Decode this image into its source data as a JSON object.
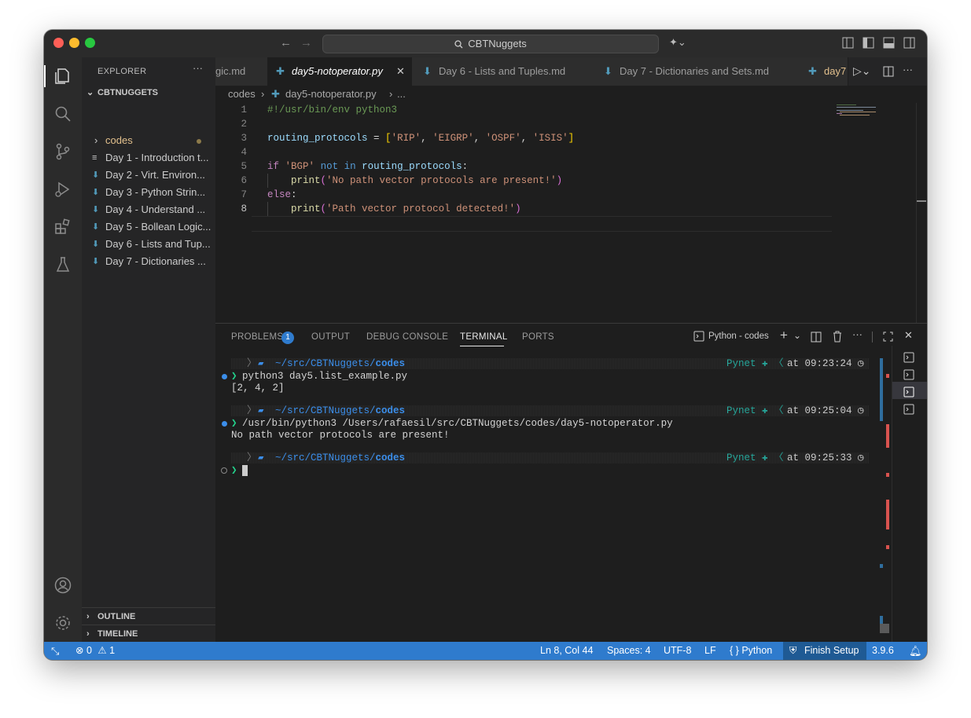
{
  "window": {
    "title": "CBTNuggets",
    "traffic_lights": {
      "close": "#ff5f57",
      "minimize": "#febc2e",
      "zoom": "#28c840"
    }
  },
  "sidebar": {
    "header": "EXPLORER",
    "project": "CBTNUGGETS",
    "items": [
      {
        "label": "codes",
        "type": "folder",
        "color": "#e2c08d"
      },
      {
        "label": "Day 1 - Introduction t...",
        "type": "md-plain"
      },
      {
        "label": "Day 2 - Virt. Environ...",
        "type": "md"
      },
      {
        "label": "Day 3 - Python Strin...",
        "type": "md"
      },
      {
        "label": "Day 4 - Understand ...",
        "type": "md"
      },
      {
        "label": "Day 5 - Bollean Logic...",
        "type": "md"
      },
      {
        "label": "Day 6 - Lists and Tup...",
        "type": "md"
      },
      {
        "label": "Day 7 - Dictionaries ..."
      }
    ],
    "outline": "OUTLINE",
    "timeline": "TIMELINE"
  },
  "tabs": [
    {
      "label": "gic.md"
    },
    {
      "label": "day5-notoperator.py",
      "active": true
    },
    {
      "label": "Day 6 - Lists and Tuples.md"
    },
    {
      "label": "Day 7 - Dictionaries and Sets.md"
    },
    {
      "label": "day7"
    }
  ],
  "breadcrumb": {
    "folder": "codes",
    "file": "day5-notoperator.py",
    "more": "..."
  },
  "editor": {
    "lines": [
      {
        "num": "1",
        "text": "#!/usr/bin/env python3"
      },
      {
        "num": "2",
        "text": ""
      },
      {
        "num": "3",
        "text": "routing_protocols = ['RIP', 'EIGRP', 'OSPF', 'ISIS']"
      },
      {
        "num": "4",
        "text": ""
      },
      {
        "num": "5",
        "text": "if 'BGP' not in routing_protocols:"
      },
      {
        "num": "6",
        "text": "    print('No path vector protocols are present!')"
      },
      {
        "num": "7",
        "text": "else:"
      },
      {
        "num": "8",
        "text": "    print('Path vector protocol detected!')"
      }
    ]
  },
  "panel": {
    "tabs": {
      "problems": "PROBLEMS",
      "problems_count": "1",
      "output": "OUTPUT",
      "debug": "DEBUG CONSOLE",
      "terminal": "TERMINAL",
      "ports": "PORTS"
    },
    "terminal_name": "Python - codes",
    "prompts": [
      {
        "path_prefix": "~/src/CBTNuggets/",
        "path_dir": "codes",
        "env": "Pynet",
        "time": "at 09:23:24",
        "command": "python3 day5.list_example.py",
        "output": "[2, 4, 2]"
      },
      {
        "path_prefix": "~/src/CBTNuggets/",
        "path_dir": "codes",
        "env": "Pynet",
        "time": "at 09:25:04",
        "command": "/usr/bin/python3 /Users/rafaesil/src/CBTNuggets/codes/day5-notoperator.py",
        "output": "No path vector protocols are present!"
      },
      {
        "path_prefix": "~/src/CBTNuggets/",
        "path_dir": "codes",
        "env": "Pynet",
        "time": "at 09:25:33",
        "command": "",
        "output": ""
      }
    ]
  },
  "status": {
    "errors": "0",
    "warnings": "1",
    "position": "Ln 8, Col 44",
    "spaces": "Spaces: 4",
    "encoding": "UTF-8",
    "eol": "LF",
    "language": "Python",
    "finish_setup": "Finish Setup",
    "version": "3.9.6"
  },
  "colors": {
    "accent": "#2f7bcd",
    "keyword": "#569cd6",
    "control": "#c586c0",
    "string": "#ce9178",
    "function": "#dcdcaa",
    "variable": "#9cdcfe",
    "comment": "#6a9955",
    "prompt_green": "#23d18b",
    "path_blue": "#3b8eea"
  }
}
